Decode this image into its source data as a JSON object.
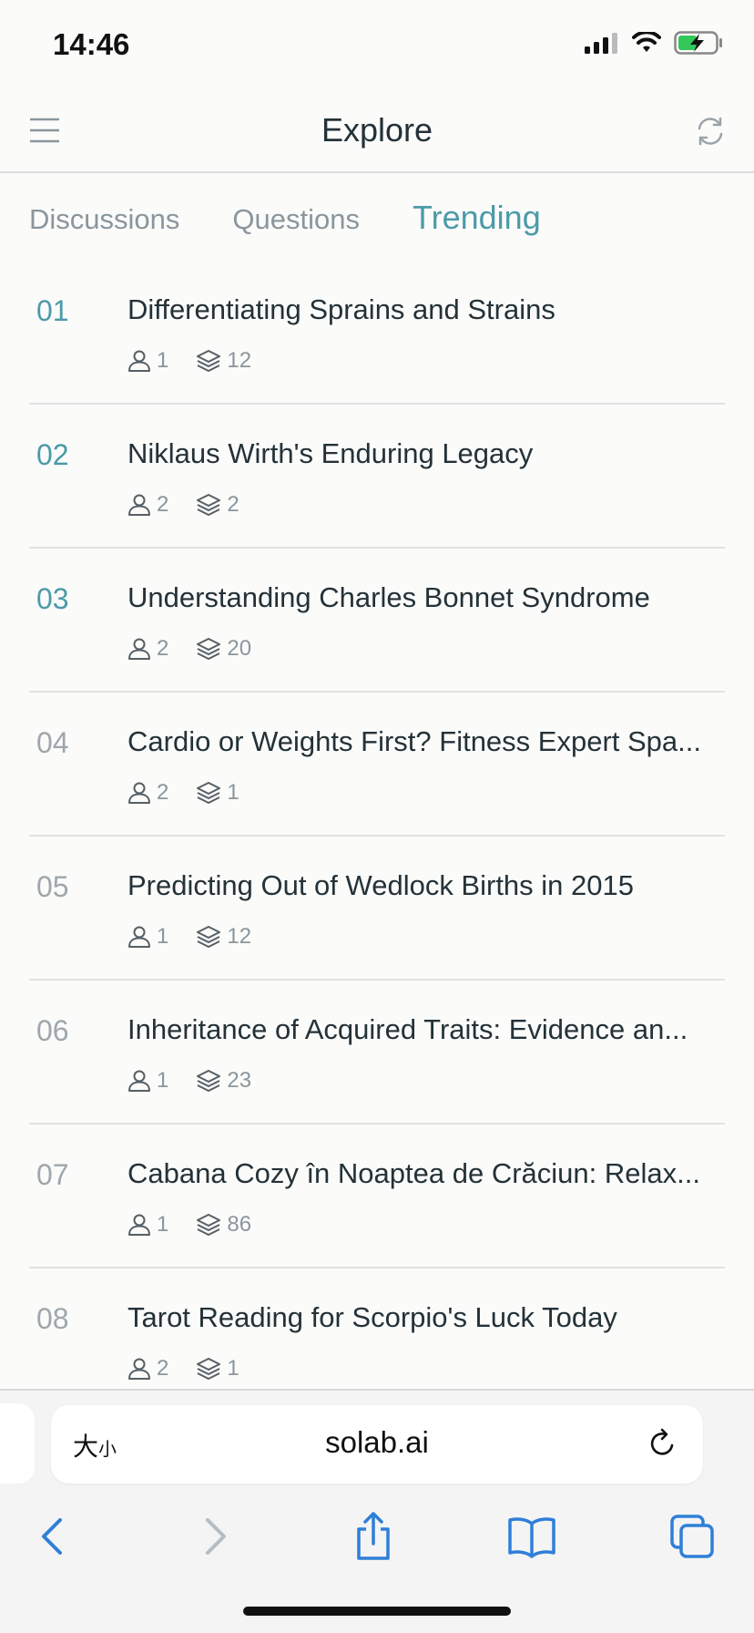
{
  "status_bar": {
    "time": "14:46"
  },
  "header": {
    "title": "Explore"
  },
  "tabs": [
    {
      "label": "Discussions",
      "active": false
    },
    {
      "label": "Questions",
      "active": false
    },
    {
      "label": "Trending",
      "active": true
    }
  ],
  "items": [
    {
      "rank": "01",
      "title": "Differentiating Sprains and Strains",
      "users": "1",
      "layers": "12",
      "highlight": true
    },
    {
      "rank": "02",
      "title": "Niklaus Wirth's Enduring Legacy",
      "users": "2",
      "layers": "2",
      "highlight": true
    },
    {
      "rank": "03",
      "title": "Understanding Charles Bonnet Syndrome",
      "users": "2",
      "layers": "20",
      "highlight": true
    },
    {
      "rank": "04",
      "title": "Cardio or Weights First? Fitness Expert Spa...",
      "users": "2",
      "layers": "1",
      "highlight": false
    },
    {
      "rank": "05",
      "title": "Predicting Out of Wedlock Births in 2015",
      "users": "1",
      "layers": "12",
      "highlight": false
    },
    {
      "rank": "06",
      "title": "Inheritance of Acquired Traits: Evidence an...",
      "users": "1",
      "layers": "23",
      "highlight": false
    },
    {
      "rank": "07",
      "title": "Cabana Cozy în Noaptea de Crăciun: Relax...",
      "users": "1",
      "layers": "86",
      "highlight": false
    },
    {
      "rank": "08",
      "title": "Tarot Reading for Scorpio's Luck Today",
      "users": "2",
      "layers": "1",
      "highlight": false
    }
  ],
  "browser": {
    "text_size_label": "大",
    "text_size_small": "小",
    "url": "solab.ai"
  },
  "colors": {
    "accent": "#4b9ba8",
    "muted": "#8a969d",
    "text": "#243238"
  }
}
